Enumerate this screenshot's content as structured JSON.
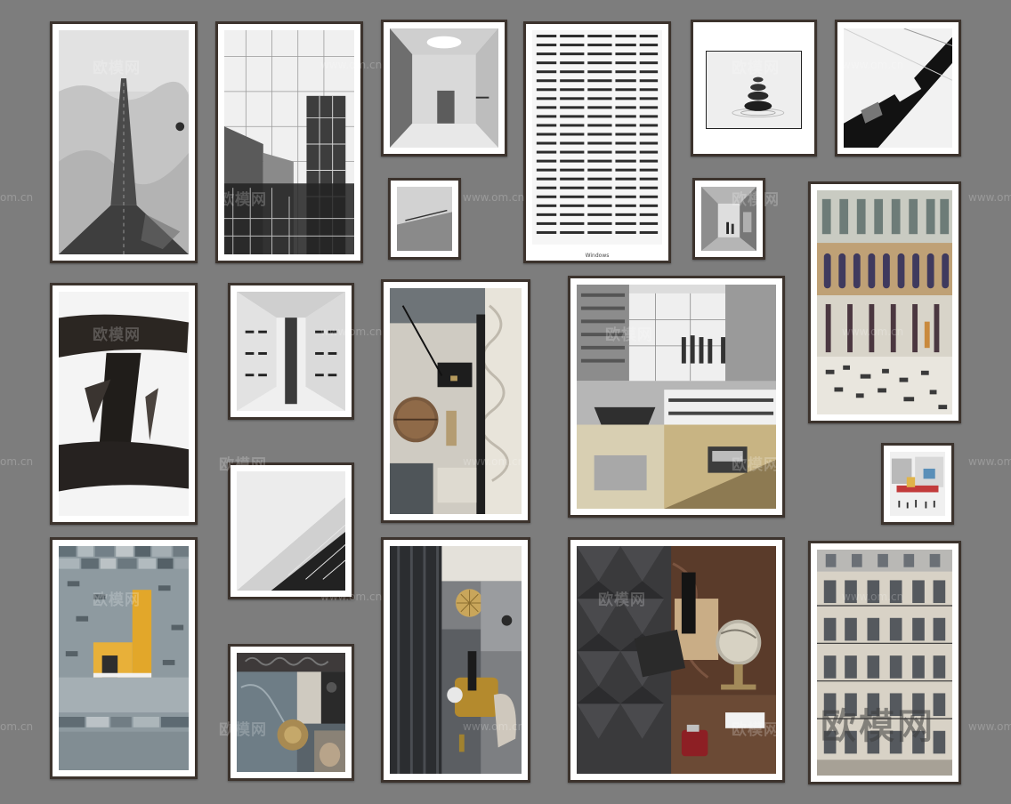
{
  "page": {
    "background": "#7d7d7d",
    "frame_color": "#3c332d"
  },
  "frames": [
    {
      "id": "desert-road",
      "subject": "desert road"
    },
    {
      "id": "grid-city",
      "subject": "grid architecture collage"
    },
    {
      "id": "corridor-skylight",
      "subject": "corridor with round skylight"
    },
    {
      "id": "highrise",
      "subject": "high-rise facade",
      "caption": "Windows"
    },
    {
      "id": "stacked-stones",
      "subject": "stacked zen stones"
    },
    {
      "id": "abstract-structure",
      "subject": "abstract black structure"
    },
    {
      "id": "small-corridor",
      "subject": "small corridor"
    },
    {
      "id": "small-gallery",
      "subject": "small gallery interior"
    },
    {
      "id": "colonnade-facade",
      "subject": "colonnade facade collage"
    },
    {
      "id": "ink-brush",
      "subject": "black ink brush strokes"
    },
    {
      "id": "symmetric-interior",
      "subject": "symmetric interior"
    },
    {
      "id": "moodboard-globe",
      "subject": "material moodboard with globe"
    },
    {
      "id": "architecture-collage",
      "subject": "black and white architecture collage"
    },
    {
      "id": "tiny-collage",
      "subject": "tiny colorful collage"
    },
    {
      "id": "diagonal-facade",
      "subject": "diagonal facade"
    },
    {
      "id": "mosaic-facade",
      "subject": "mosaic facade with yellow window"
    },
    {
      "id": "ornament-moodboard",
      "subject": "ornament moodboard"
    },
    {
      "id": "brass-moodboard",
      "subject": "brass objects moodboard"
    },
    {
      "id": "wood-globe-moodboard",
      "subject": "wood panels and globe moodboard"
    },
    {
      "id": "paris-facade",
      "subject": "Parisian facade"
    }
  ],
  "watermarks": {
    "brand_cn": "欧模网",
    "url": "www.om.cn",
    "url_short": "om.cn"
  }
}
